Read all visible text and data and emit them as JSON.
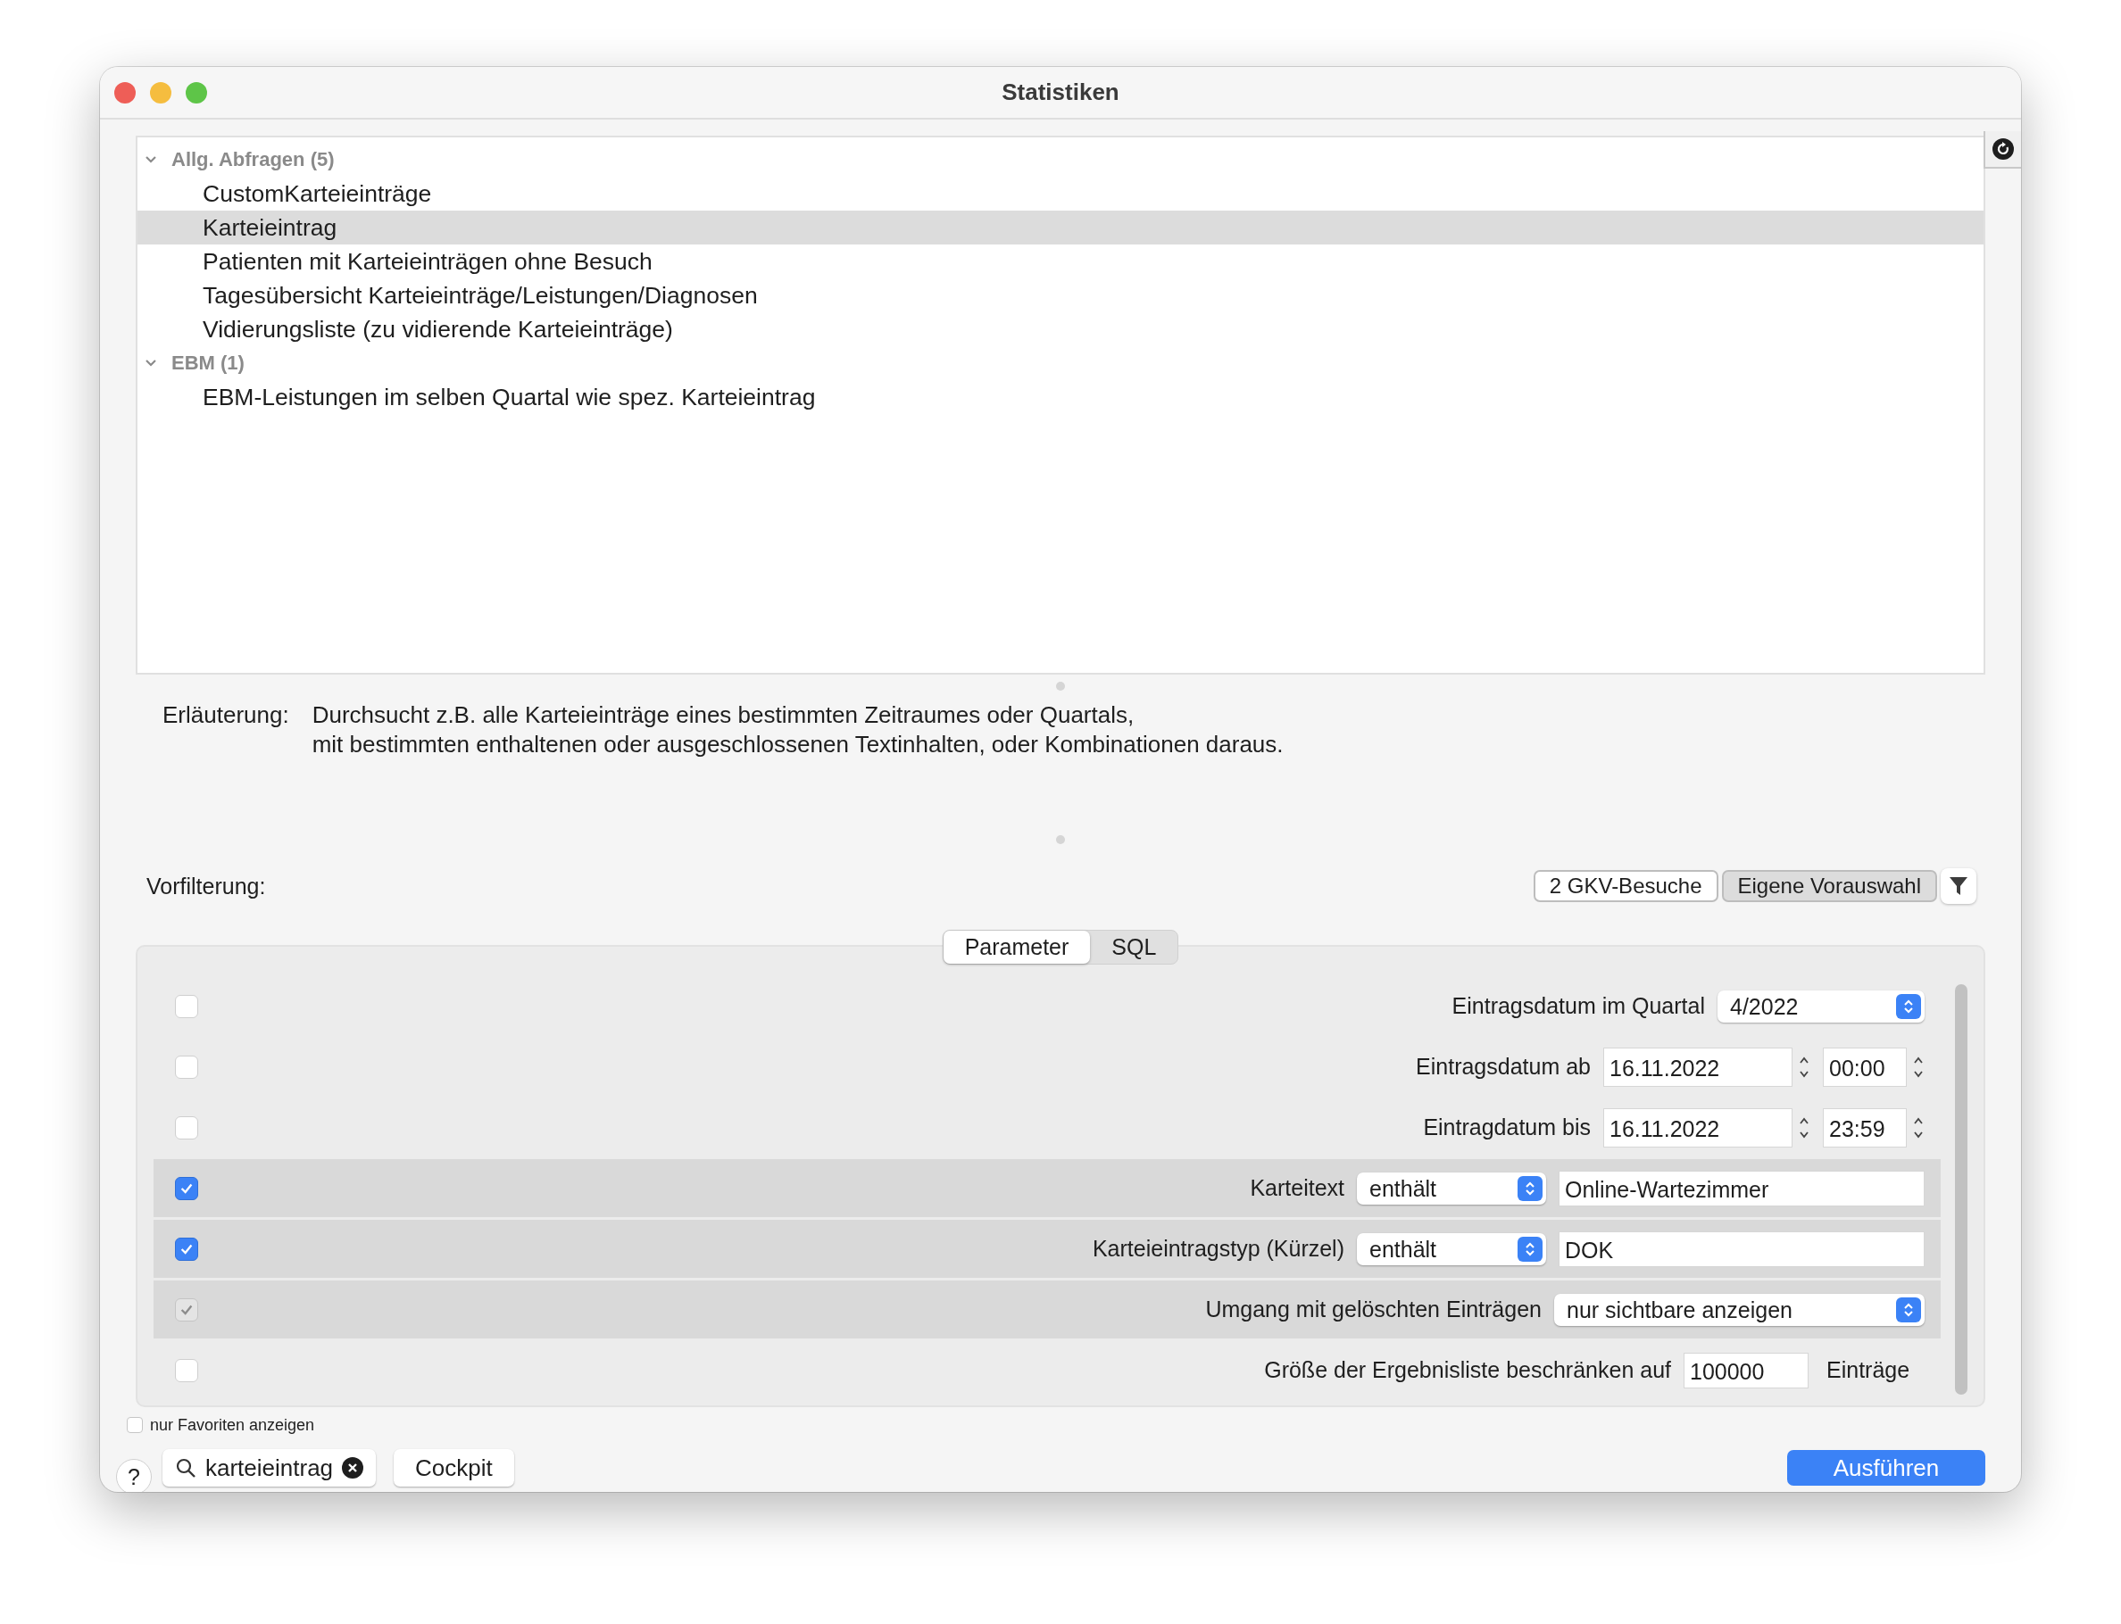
{
  "window": {
    "title": "Statistiken"
  },
  "tree": [
    {
      "label": "Allg. Abfragen (5)",
      "expanded": true,
      "children": [
        {
          "label": "CustomKarteieinträge",
          "selected": false
        },
        {
          "label": "Karteieintrag",
          "selected": true
        },
        {
          "label": "Patienten mit Karteieinträgen ohne Besuch",
          "selected": false
        },
        {
          "label": "Tagesübersicht Karteieinträge/Leistungen/Diagnosen",
          "selected": false
        },
        {
          "label": "Vidierungsliste (zu vidierende Karteieinträge)",
          "selected": false
        }
      ]
    },
    {
      "label": "EBM (1)",
      "expanded": true,
      "children": [
        {
          "label": "EBM-Leistungen im selben Quartal wie spez. Karteieintrag",
          "selected": false
        }
      ]
    }
  ],
  "explanation": {
    "label": "Erläuterung:",
    "lines": [
      "Durchsucht z.B. alle Karteieinträge eines bestimmten Zeitraumes oder Quartals,",
      "mit bestimmten enthaltenen oder ausgeschlossenen Textinhalten, oder Kombinationen daraus."
    ]
  },
  "prefilter": {
    "label": "Vorfilterung:",
    "buttons": [
      {
        "label": "2 GKV-Besuche",
        "selected": false
      },
      {
        "label": "Eigene Vorauswahl",
        "selected": true
      }
    ]
  },
  "tabs": [
    {
      "label": "Parameter",
      "selected": true
    },
    {
      "label": "SQL",
      "selected": false
    }
  ],
  "parameters": [
    {
      "kind": "select",
      "checked": false,
      "label": "Eintragsdatum im Quartal",
      "value": "4/2022"
    },
    {
      "kind": "datetime",
      "checked": false,
      "label": "Eintragsdatum ab",
      "date": "16.11.2022",
      "time": "00:00"
    },
    {
      "kind": "datetime",
      "checked": false,
      "label": "Eintragdatum bis",
      "date": "16.11.2022",
      "time": "23:59"
    },
    {
      "kind": "match",
      "checked": true,
      "label": "Karteitext",
      "operator": "enthält",
      "value": "Online-Wartezimmer"
    },
    {
      "kind": "match",
      "checked": true,
      "label": "Karteieintragstyp (Kürzel)",
      "operator": "enthält",
      "value": "DOK"
    },
    {
      "kind": "select",
      "checked": true,
      "disabled": true,
      "label": "Umgang mit gelöschten Einträgen",
      "value": "nur sichtbare anzeigen"
    },
    {
      "kind": "limit",
      "checked": false,
      "label": "Größe der Ergebnisliste beschränken auf",
      "value": "100000",
      "suffix": "Einträge"
    }
  ],
  "favorites": {
    "label": "nur Favoriten anzeigen",
    "checked": false
  },
  "help": "?",
  "search": {
    "value": "karteieintrag"
  },
  "cockpit": "Cockpit",
  "run": "Ausführen"
}
